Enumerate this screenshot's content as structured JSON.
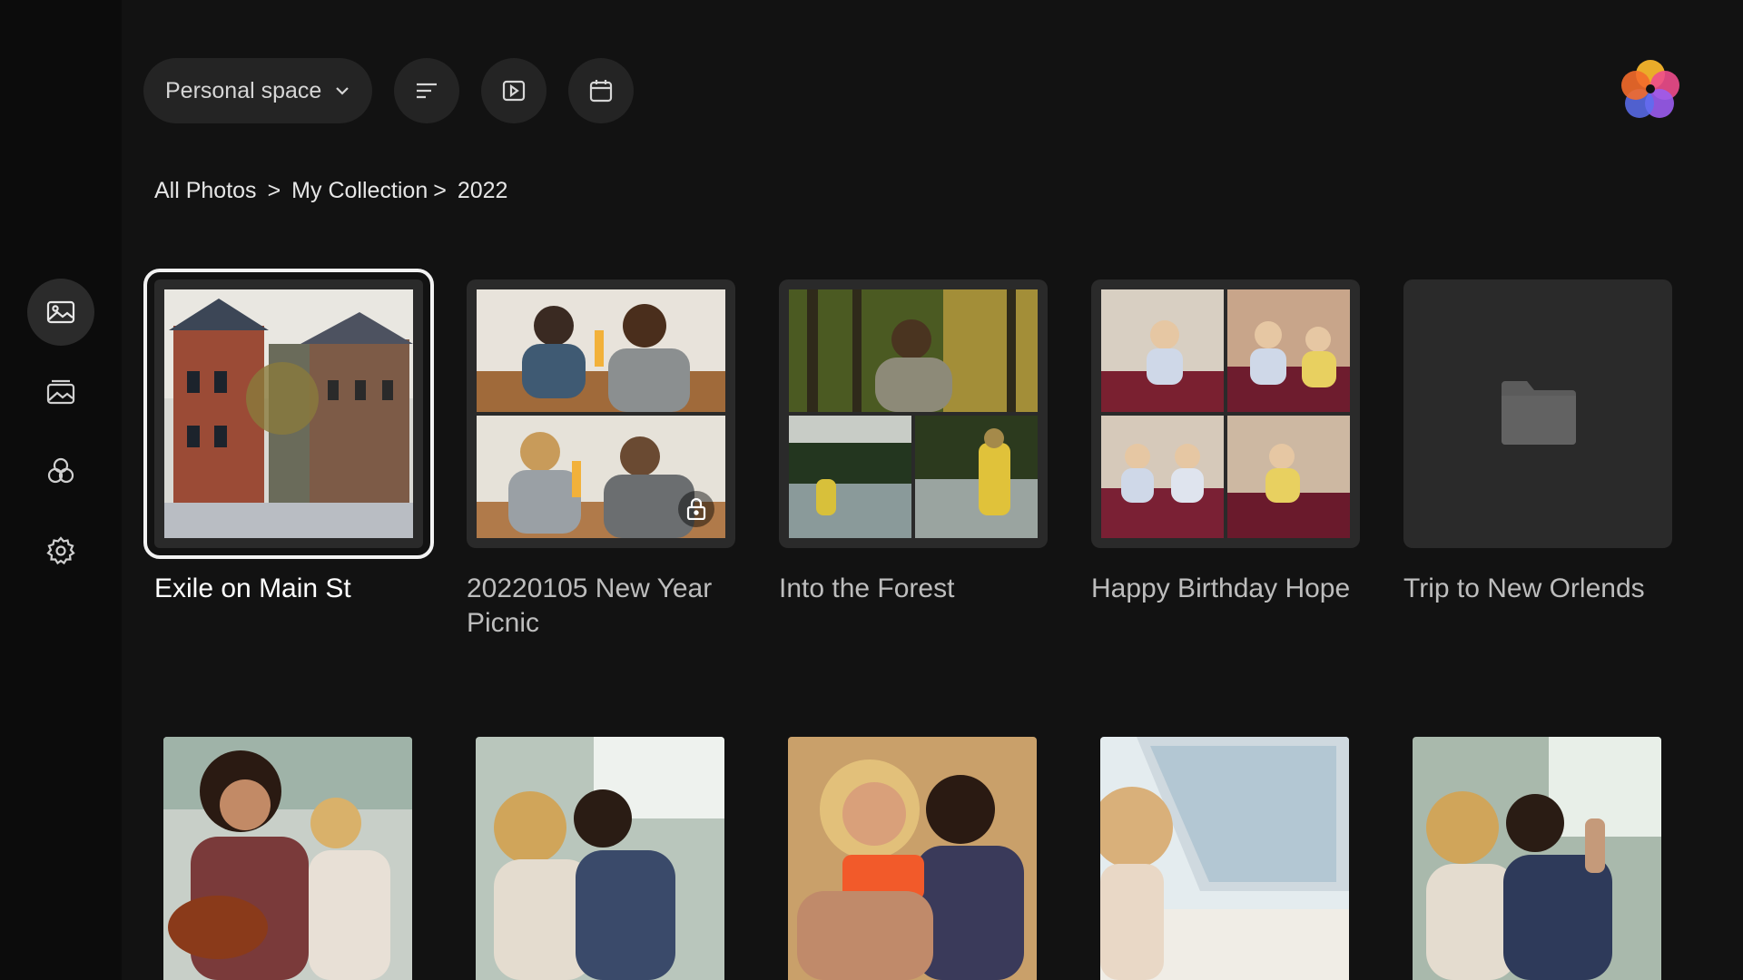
{
  "sidebar": {
    "items": [
      {
        "icon": "photos-icon",
        "active": true
      },
      {
        "icon": "albums-icon",
        "active": false
      },
      {
        "icon": "shared-icon",
        "active": false
      },
      {
        "icon": "gear-icon",
        "active": false
      }
    ]
  },
  "toolbar": {
    "space_label": "Personal space",
    "buttons": [
      "sort-icon",
      "slideshow-icon",
      "calendar-icon"
    ]
  },
  "breadcrumb": {
    "root": "All Photos",
    "sep1": ">",
    "middle": "My Collection",
    "sep2": ">",
    "current": "2022"
  },
  "albums": [
    {
      "title": "Exile on Main St",
      "selected": true,
      "locked": false
    },
    {
      "title": "20220105 New Year Picnic",
      "selected": false,
      "locked": true
    },
    {
      "title": "Into the Forest",
      "selected": false,
      "locked": false
    },
    {
      "title": "Happy Birthday Hope",
      "selected": false,
      "locked": false
    },
    {
      "title": "Trip to New Orlends",
      "selected": false,
      "locked": false,
      "empty": true
    }
  ],
  "photos_row_count": 5,
  "colors": {
    "background": "#121212",
    "rail": "#0c0c0c",
    "tile": "#2a2a2a",
    "selected_outline": "#f2f2f2"
  }
}
